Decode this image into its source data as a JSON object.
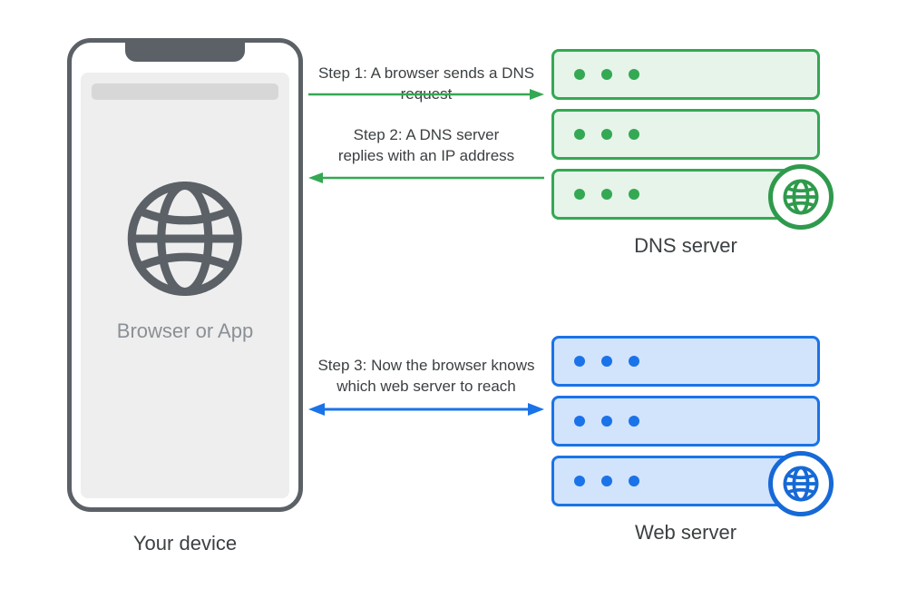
{
  "device": {
    "browser_label": "Browser or App",
    "caption": "Your device"
  },
  "dns": {
    "caption": "DNS server"
  },
  "web": {
    "caption": "Web server"
  },
  "steps": {
    "s1": "Step 1: A browser sends a DNS request",
    "s2_line1": "Step 2: A DNS server",
    "s2_line2": "replies with an IP address",
    "s3_line1": "Step 3: Now the browser knows",
    "s3_line2": "which web server to reach"
  },
  "colors": {
    "device_outline": "#5b6166",
    "dns": "#34a853",
    "web": "#1a73e8"
  }
}
